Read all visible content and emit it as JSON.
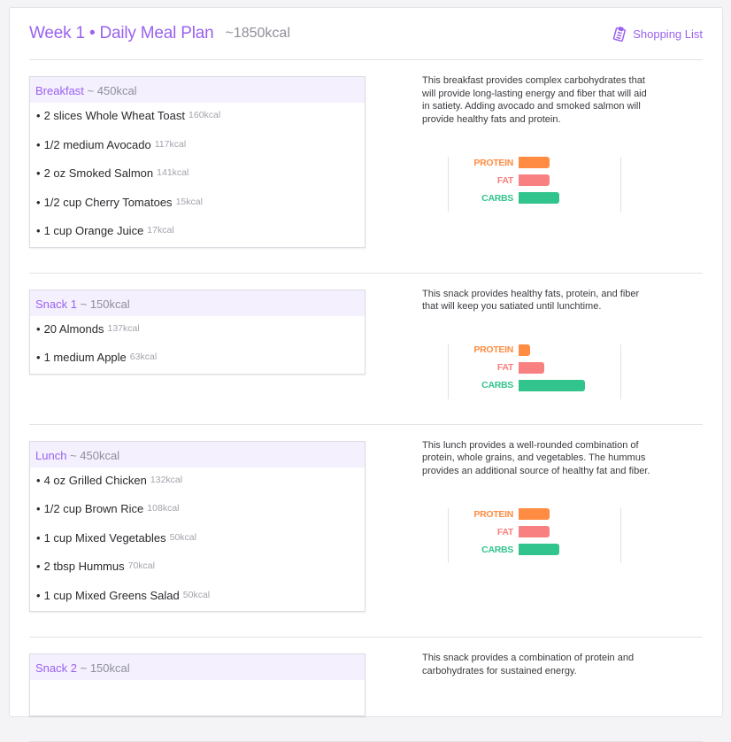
{
  "header": {
    "title": "Week 1 • Daily Meal Plan",
    "total": "~1850kcal",
    "shopping_list": "Shopping List"
  },
  "macro_labels": {
    "protein": "PROTEIN",
    "fat": "FAT",
    "carbs": "CARBS"
  },
  "colors": {
    "accent": "#9a62f0",
    "protein": "#ff8c42",
    "fat": "#f98080",
    "carbs": "#31c48d"
  },
  "meals": [
    {
      "name": "Breakfast",
      "kcal": "~ 450kcal",
      "description": "This breakfast provides complex carbohydrates that will provide long-lasting energy and fiber that will aid in satiety. Adding avocado and smoked salmon will provide healthy fats and protein.",
      "items": [
        {
          "label": "2 slices Whole Wheat Toast",
          "kcal": "160kcal"
        },
        {
          "label": "1/2 medium Avocado",
          "kcal": "117kcal"
        },
        {
          "label": "2 oz Smoked Salmon",
          "kcal": "141kcal"
        },
        {
          "label": "1/2 cup Cherry Tomatoes",
          "kcal": "15kcal"
        },
        {
          "label": "1 cup Orange Juice",
          "kcal": "17kcal"
        }
      ],
      "macros_percent": {
        "protein": 31,
        "fat": 31,
        "carbs": 40
      }
    },
    {
      "name": "Snack 1",
      "kcal": "~ 150kcal",
      "description": "This snack provides healthy fats, protein, and fiber that will keep you satiated until lunchtime.",
      "items": [
        {
          "label": "20 Almonds",
          "kcal": "137kcal"
        },
        {
          "label": "1 medium Apple",
          "kcal": "63kcal"
        }
      ],
      "macros_percent": {
        "protein": 11,
        "fat": 25,
        "carbs": 66
      }
    },
    {
      "name": "Lunch",
      "kcal": "~ 450kcal",
      "description": "This lunch provides a well-rounded combination of protein, whole grains, and vegetables. The hummus provides an additional source of healthy fat and fiber.",
      "items": [
        {
          "label": "4 oz Grilled Chicken",
          "kcal": "132kcal"
        },
        {
          "label": "1/2 cup Brown Rice",
          "kcal": "108kcal"
        },
        {
          "label": "1 cup Mixed Vegetables",
          "kcal": "50kcal"
        },
        {
          "label": "2 tbsp Hummus",
          "kcal": "70kcal"
        },
        {
          "label": "1 cup Mixed Greens Salad",
          "kcal": "50kcal"
        }
      ],
      "macros_percent": {
        "protein": 31,
        "fat": 31,
        "carbs": 40
      }
    },
    {
      "name": "Snack 2",
      "kcal": "~ 150kcal",
      "description": "This snack provides a combination of protein and carbohydrates for sustained energy.",
      "items": [],
      "macros_percent": null
    }
  ]
}
